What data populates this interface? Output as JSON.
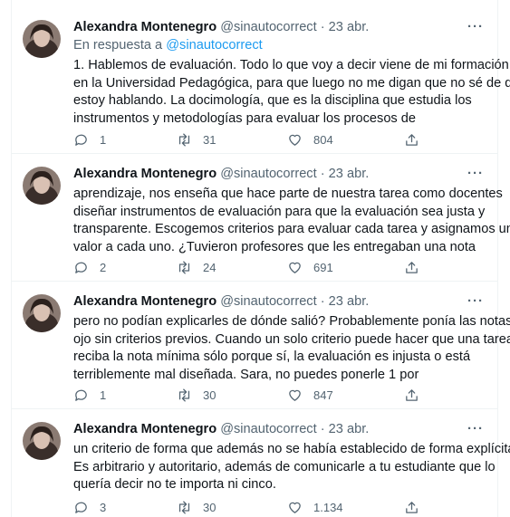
{
  "author": {
    "name": "Alexandra Montenegro",
    "handle": "@sinautocorrect",
    "separator": "·",
    "more": "···"
  },
  "reply_prefix": "En respuesta a",
  "reply_handle": "@sinautocorrect",
  "icons": {
    "reply": "reply-icon",
    "retweet": "retweet-icon",
    "like": "heart-icon",
    "share": "share-icon",
    "more": "more-icon"
  },
  "tweets": [
    {
      "date": "23 abr.",
      "lines": [
        "1. Hablemos de evaluación. Todo lo que voy a decir viene de mi formación",
        "en la Universidad Pedagógica, para que luego no me digan que no sé de qué",
        "estoy hablando. La docimología, que es la disciplina que estudia los",
        "instrumentos y metodologías para evaluar los procesos de"
      ],
      "replies": "1",
      "retweets": "31",
      "likes": "804"
    },
    {
      "date": "23 abr.",
      "lines": [
        "aprendizaje, nos enseña que hace parte de nuestra tarea como docentes",
        "diseñar instrumentos de evaluación para que la evaluación sea justa y",
        "transparente. Escogemos criterios para evaluar cada tarea y asignamos un",
        "valor a cada uno. ¿Tuvieron profesores que les entregaban una nota"
      ],
      "replies": "2",
      "retweets": "24",
      "likes": "691"
    },
    {
      "date": "23 abr.",
      "lines": [
        "pero no podían explicarles de dónde salió? Probablemente ponía las notas a",
        "ojo sin criterios previos. Cuando un solo criterio puede hacer que una tarea",
        "reciba la nota mínima sólo porque sí, la evaluación es injusta o está",
        "terriblemente mal diseñada. Sara, no puedes ponerle 1 por"
      ],
      "replies": "1",
      "retweets": "30",
      "likes": "847"
    },
    {
      "date": "23 abr.",
      "lines": [
        "un criterio de forma que además no se había establecido de forma explícita.",
        "Es arbitrario y autoritario, además de comunicarle a tu estudiante que lo",
        "quería decir no te importa ni cinco."
      ],
      "replies": "3",
      "retweets": "30",
      "likes": "1.134"
    }
  ]
}
